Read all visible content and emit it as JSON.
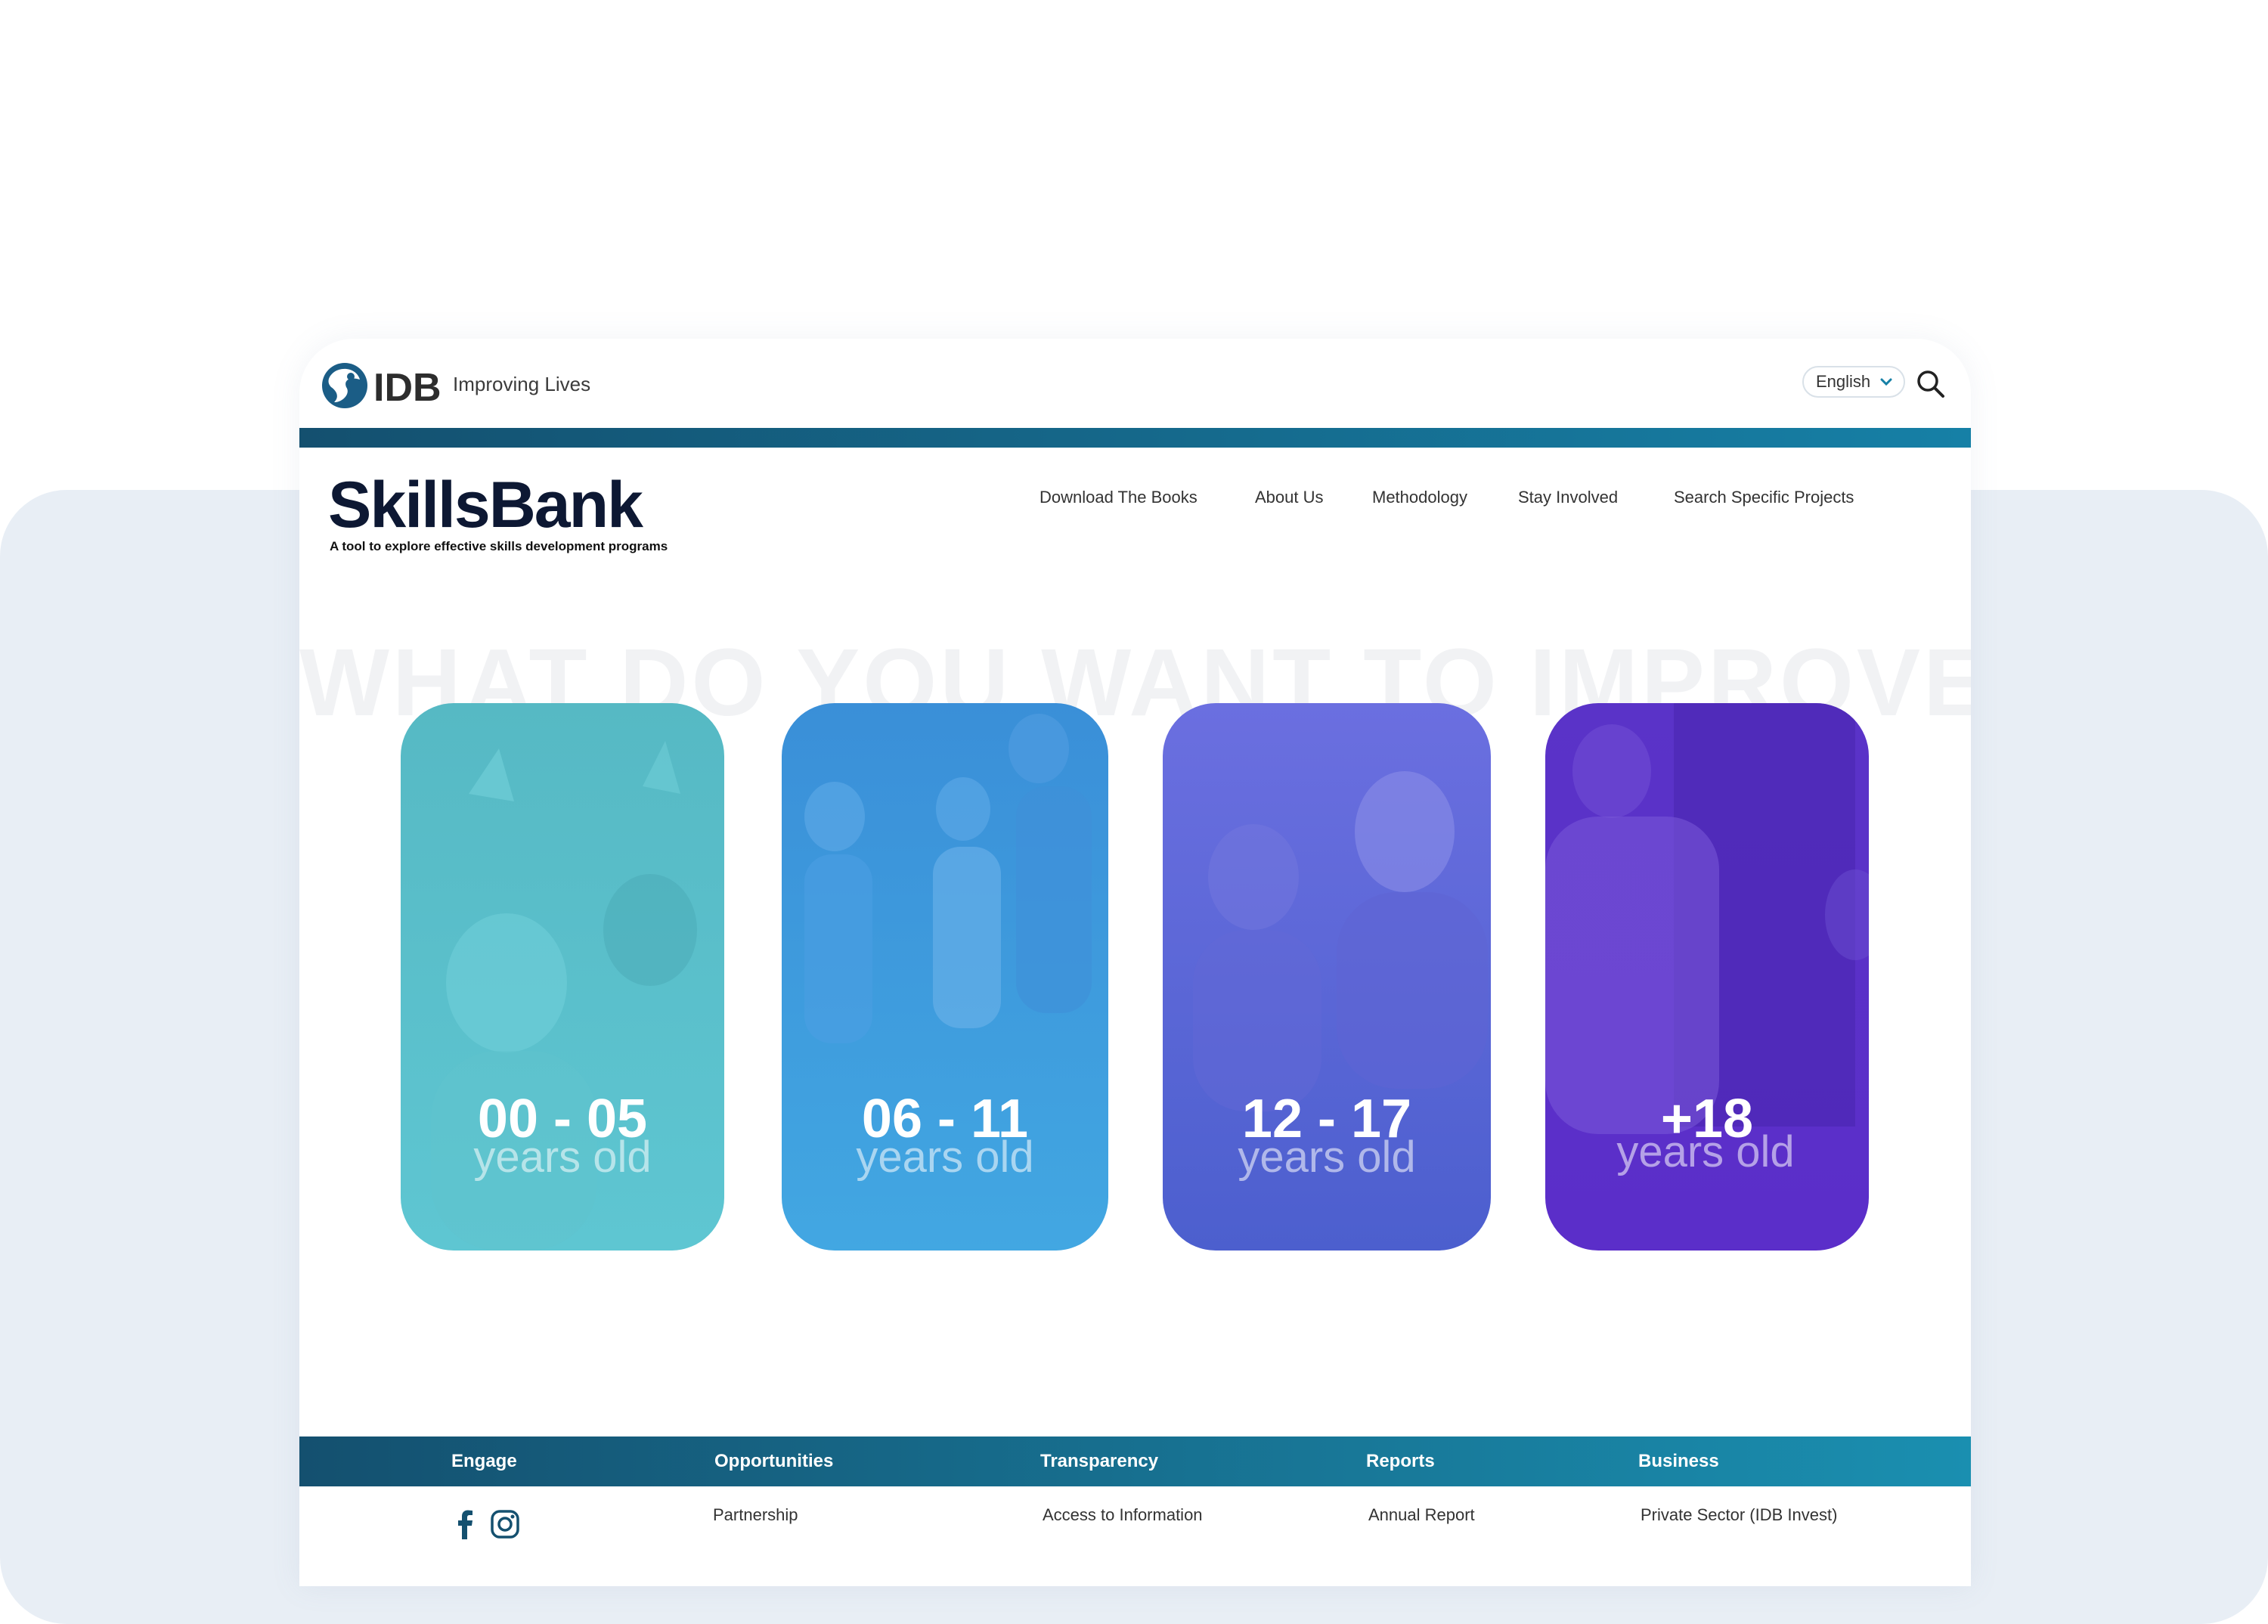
{
  "topbar": {
    "logo_text": "IDB",
    "tagline": "Improving Lives",
    "language": "English"
  },
  "site": {
    "title": "SkillsBank",
    "subtitle": "A tool to explore effective skills development programs"
  },
  "nav": {
    "items": [
      "Download The Books",
      "About Us",
      "Methodology",
      "Stay Involved",
      "Search Specific Projects"
    ]
  },
  "hero": {
    "watermark": "WHAT DO YOU WANT TO IMPROVE?",
    "cards": [
      {
        "age": "00 - 05",
        "label": "years old",
        "color_top": "#56b9c4",
        "color_bottom": "#5ec6d2"
      },
      {
        "age": "06 - 11",
        "label": "years old",
        "color_top": "#3a8fd8",
        "color_bottom": "#42a7e2"
      },
      {
        "age": "12 - 17",
        "label": "years old",
        "color_top": "#5a62d6",
        "color_bottom": "#4c5fce"
      },
      {
        "age": "+18",
        "label": "years old",
        "color_top": "#5a2fc6",
        "color_bottom": "#5b2ec9"
      }
    ]
  },
  "footer": {
    "headings": [
      "Engage",
      "Opportunities",
      "Transparency",
      "Reports",
      "Business"
    ],
    "links": [
      "Partnership",
      "Access to Information",
      "Annual Report",
      "Private Sector (IDB Invest)"
    ],
    "social_icons": [
      "facebook-icon",
      "instagram-icon"
    ]
  },
  "colors": {
    "accent_dark": "#14506f",
    "accent_light": "#1a8fb0",
    "brand_navy": "#0d1833",
    "background_panel": "#e8eef5"
  }
}
